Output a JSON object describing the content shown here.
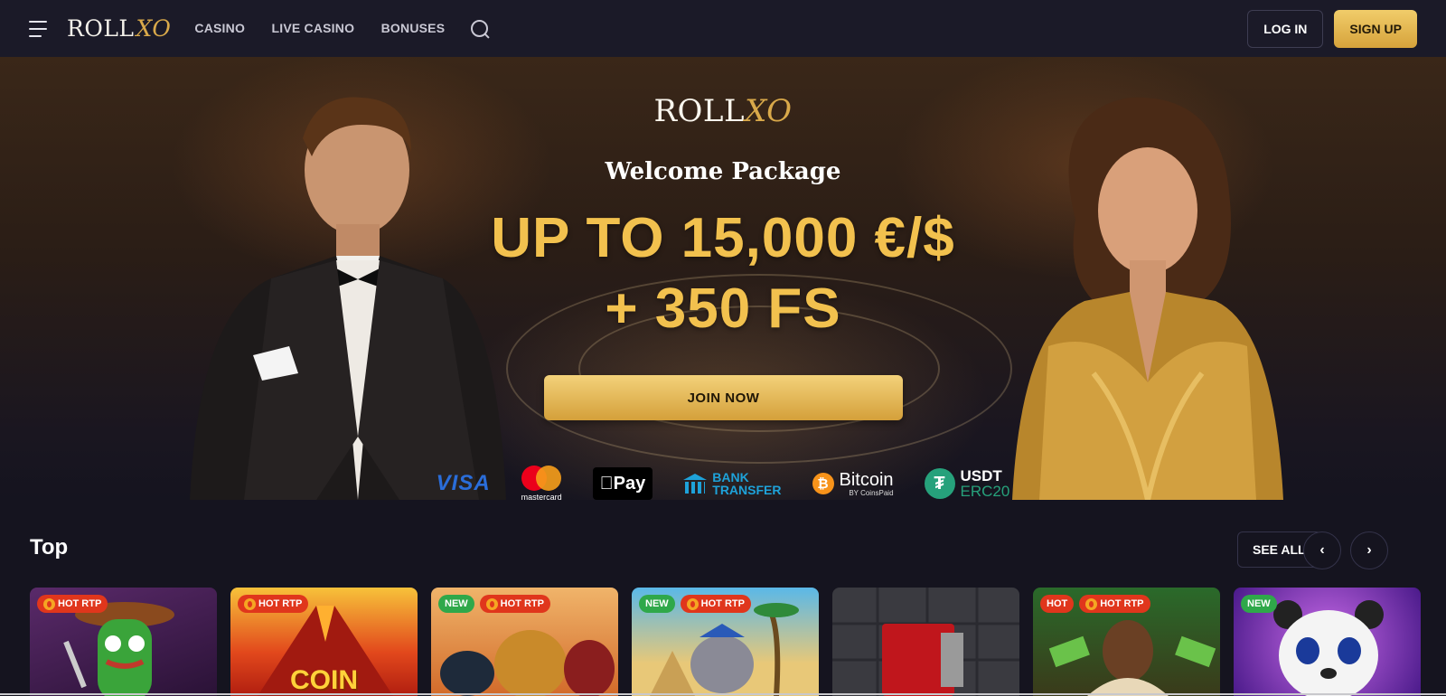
{
  "header": {
    "logo_text": "ROLL",
    "logo_xo": "XO",
    "nav": [
      "CASINO",
      "LIVE CASINO",
      "BONUSES"
    ],
    "login_label": "LOG IN",
    "signup_label": "SIGN UP",
    "icons": [
      "menu-icon",
      "search-icon"
    ]
  },
  "hero": {
    "logo_text": "ROLL",
    "logo_xo": "XO",
    "subtitle": "Welcome Package",
    "amount": "UP TO 15,000 €/$",
    "free_spins": "+ 350 FS",
    "cta_label": "JOIN NOW",
    "payments": {
      "visa": "VISA",
      "mastercard": "mastercard",
      "applepay": "Pay",
      "bank_line1": "BANK",
      "bank_line2": "TRANSFER",
      "bitcoin": "Bitcoin",
      "bitcoin_sub": "BY CoinsPaid",
      "usdt_line1": "USDT",
      "usdt_line2": "ERC20"
    }
  },
  "top_section": {
    "title": "Top",
    "see_all_label": "SEE ALL",
    "prev_icon": "‹",
    "next_icon": "›"
  },
  "games": [
    {
      "badges": [
        "HOT RTP"
      ],
      "title": ""
    },
    {
      "badges": [
        "HOT RTP"
      ],
      "title": "COIN"
    },
    {
      "badges": [
        "NEW",
        "HOT RTP"
      ],
      "title": ""
    },
    {
      "badges": [
        "NEW",
        "HOT RTP"
      ],
      "title": ""
    },
    {
      "badges": [],
      "title": ""
    },
    {
      "badges": [
        "HOT",
        "HOT RTP"
      ],
      "title": ""
    },
    {
      "badges": [
        "NEW"
      ],
      "title": ""
    }
  ],
  "colors": {
    "gold": "#f2c14e",
    "background": "#15141f",
    "header": "#1b1a28"
  }
}
